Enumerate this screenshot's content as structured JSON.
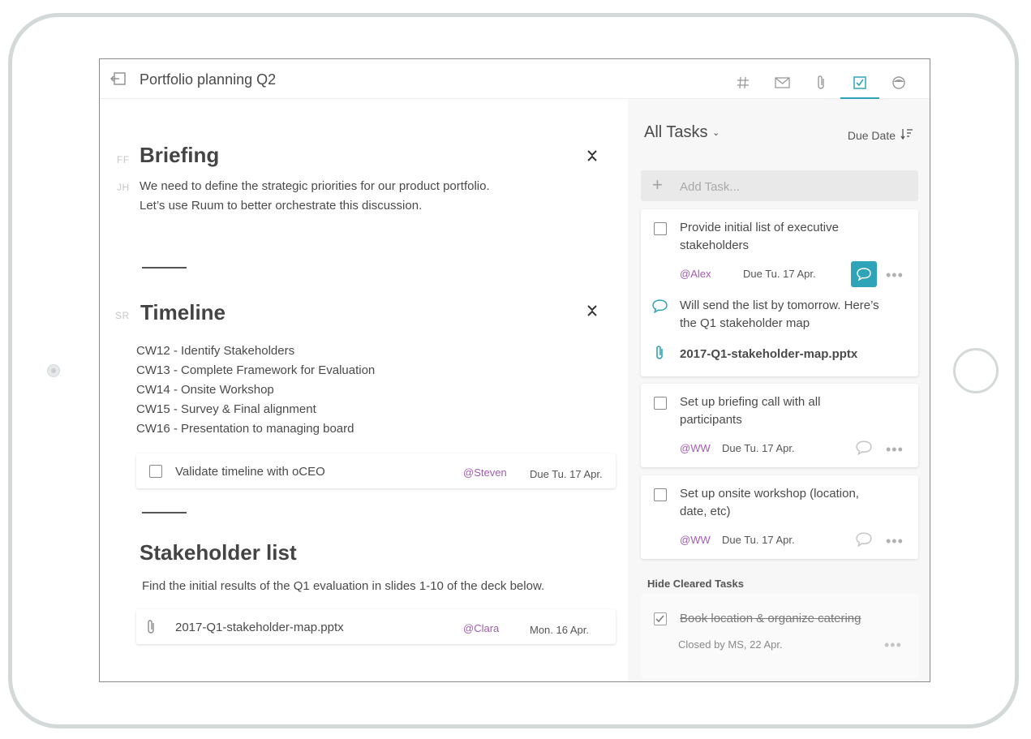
{
  "header": {
    "title": "Portfolio planning Q2",
    "icons": [
      "back-icon",
      "hashtag-icon",
      "mail-icon",
      "attachment-icon",
      "tasks-icon",
      "profile-icon"
    ],
    "active_tab": "tasks-icon",
    "accent_color": "#2fa3b8"
  },
  "briefing": {
    "initials": [
      "FF",
      "JH"
    ],
    "title": "Briefing",
    "line1": "We need to define the strategic priorities for our product portfolio.",
    "line2": "Let’s use Ruum to better orchestrate this discussion."
  },
  "timeline": {
    "initials": "SR",
    "title": "Timeline",
    "items": [
      "CW12 - Identify Stakeholders",
      "CW13 - Complete Framework for Evaluation",
      "CW14 - Onsite Workshop",
      "CW15 - Survey & Final alignment",
      "CW16 - Presentation to managing board"
    ],
    "task": {
      "text": "Validate timeline with oCEO",
      "assignee": "@Steven",
      "due": "Due Tu. 17 Apr."
    }
  },
  "stakeholders": {
    "title": "Stakeholder list",
    "text": "Find the initial results of the Q1 evaluation in slides 1-10 of the deck below.",
    "file": {
      "name": "2017-Q1-stakeholder-map.pptx",
      "uploader": "@Clara",
      "date": "Mon. 16 Apr."
    }
  },
  "tasks_panel": {
    "title": "All Tasks",
    "sort_label": "Due Date",
    "add_placeholder": "Add Task...",
    "tasks": [
      {
        "line1": "Provide initial list of executive",
        "line2": "stakeholders",
        "assignee": "@Alex",
        "due": "Due Tu. 17 Apr.",
        "comment_line1": "Will send the list by tomorrow. Here’s",
        "comment_line2": "the Q1 stakeholder map",
        "attachment": "2017-Q1-stakeholder-map.pptx"
      },
      {
        "line1": "Set up briefing call with all",
        "line2": "participants",
        "assignee": "@WW",
        "due": "Due Tu. 17 Apr."
      },
      {
        "line1": "Set up onsite workshop (location,",
        "line2": "date, etc)",
        "assignee": "@WW",
        "due": "Due Tu. 17 Apr."
      }
    ],
    "hide_cleared": "Hide Cleared Tasks",
    "cleared": {
      "text": "Book location & organize catering",
      "closed": "Closed by MS, 22 Apr."
    },
    "more": "•••"
  }
}
